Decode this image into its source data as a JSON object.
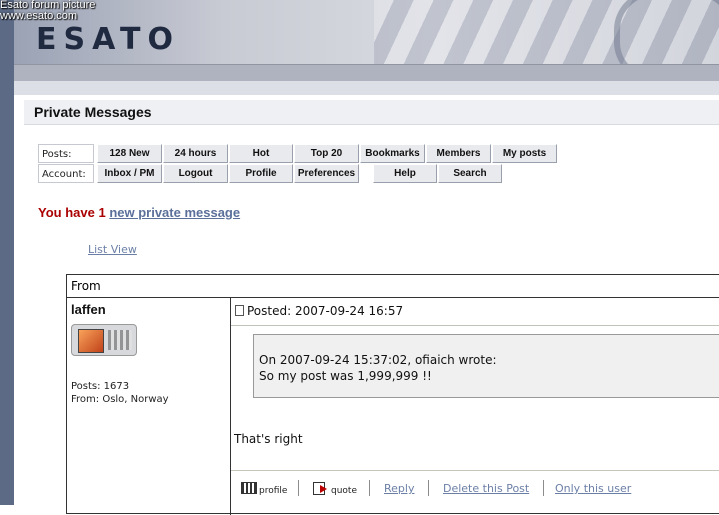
{
  "watermark": {
    "line1": "Esato forum picture",
    "line2": "www.esato.com"
  },
  "brand": {
    "logo_text": "ESATO"
  },
  "page": {
    "title": "Private Messages"
  },
  "nav": {
    "posts_label": "Posts:",
    "account_label": "Account:",
    "posts_buttons": [
      "128 New",
      "24 hours",
      "Hot",
      "Top 20",
      "Bookmarks",
      "Members",
      "My posts"
    ],
    "account_buttons": [
      "Inbox / PM",
      "Logout",
      "Profile",
      "Preferences",
      "Help",
      "Search"
    ]
  },
  "notice": {
    "prefix": "You have 1",
    "link": "new private message"
  },
  "list_view": "List View",
  "table": {
    "header": "From"
  },
  "post": {
    "author": "laffen",
    "posts": "Posts: 1673",
    "location": "From: Oslo, Norway",
    "posted": "Posted: 2007-09-24 16:57",
    "quote_line1": "On 2007-09-24 15:37:02, ofiaich wrote:",
    "quote_line2": "So my post was 1,999,999 !!",
    "body": "That's right",
    "actions": {
      "profile": "profile",
      "quote": "quote",
      "reply": "Reply",
      "delete": "Delete this Post",
      "only_user": "Only this user"
    }
  },
  "icons": {
    "document": "document-icon",
    "profile": "profile-icon",
    "quote": "quote-icon"
  }
}
